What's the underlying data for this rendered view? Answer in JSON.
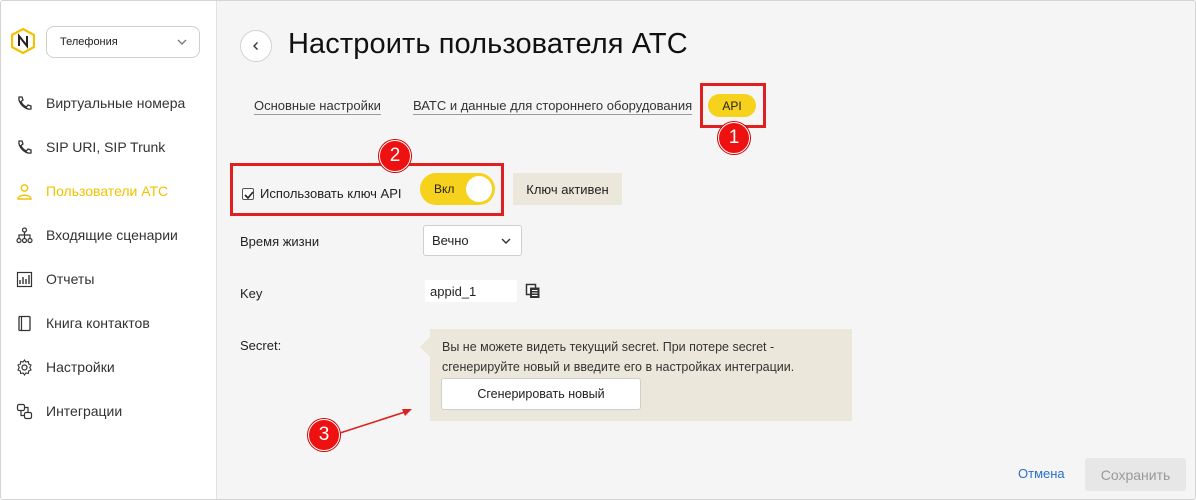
{
  "sidebar": {
    "product_select": "Телефония",
    "items": [
      {
        "label": "Виртуальные номера",
        "icon": "phone-icon"
      },
      {
        "label": "SIP URI, SIP Trunk",
        "icon": "phone-icon"
      },
      {
        "label": "Пользователи АТС",
        "icon": "user-icon",
        "active": true
      },
      {
        "label": "Входящие сценарии",
        "icon": "flow-icon"
      },
      {
        "label": "Отчеты",
        "icon": "chart-icon"
      },
      {
        "label": "Книга контактов",
        "icon": "book-icon"
      },
      {
        "label": "Настройки",
        "icon": "gear-icon"
      },
      {
        "label": "Интеграции",
        "icon": "integration-icon"
      }
    ]
  },
  "header": {
    "title": "Настроить пользователя АТС"
  },
  "tabs": [
    {
      "label": "Основные настройки"
    },
    {
      "label": "ВАТС и данные для стороннего оборудования"
    },
    {
      "label": "API",
      "active": true
    }
  ],
  "api": {
    "use_key_label": "Использовать ключ API",
    "use_key_checked": true,
    "toggle_label": "Вкл",
    "status": "Ключ активен",
    "lifetime_label": "Время жизни",
    "lifetime_value": "Вечно",
    "key_label": "Key",
    "key_value": "appid_1",
    "secret_label": "Secret:",
    "secret_note": "Вы не можете видеть текущий secret. При потере secret - сгенерируйте новый и введите его в настройках интеграции.",
    "generate_button": "Сгенерировать новый"
  },
  "footer": {
    "cancel": "Отмена",
    "save": "Сохранить"
  },
  "annotations": {
    "marker_1": "1",
    "marker_2": "2",
    "marker_3": "3"
  },
  "colors": {
    "accent": "#f7d21c",
    "annotation": "#e02020",
    "link": "#2a6fc9"
  }
}
